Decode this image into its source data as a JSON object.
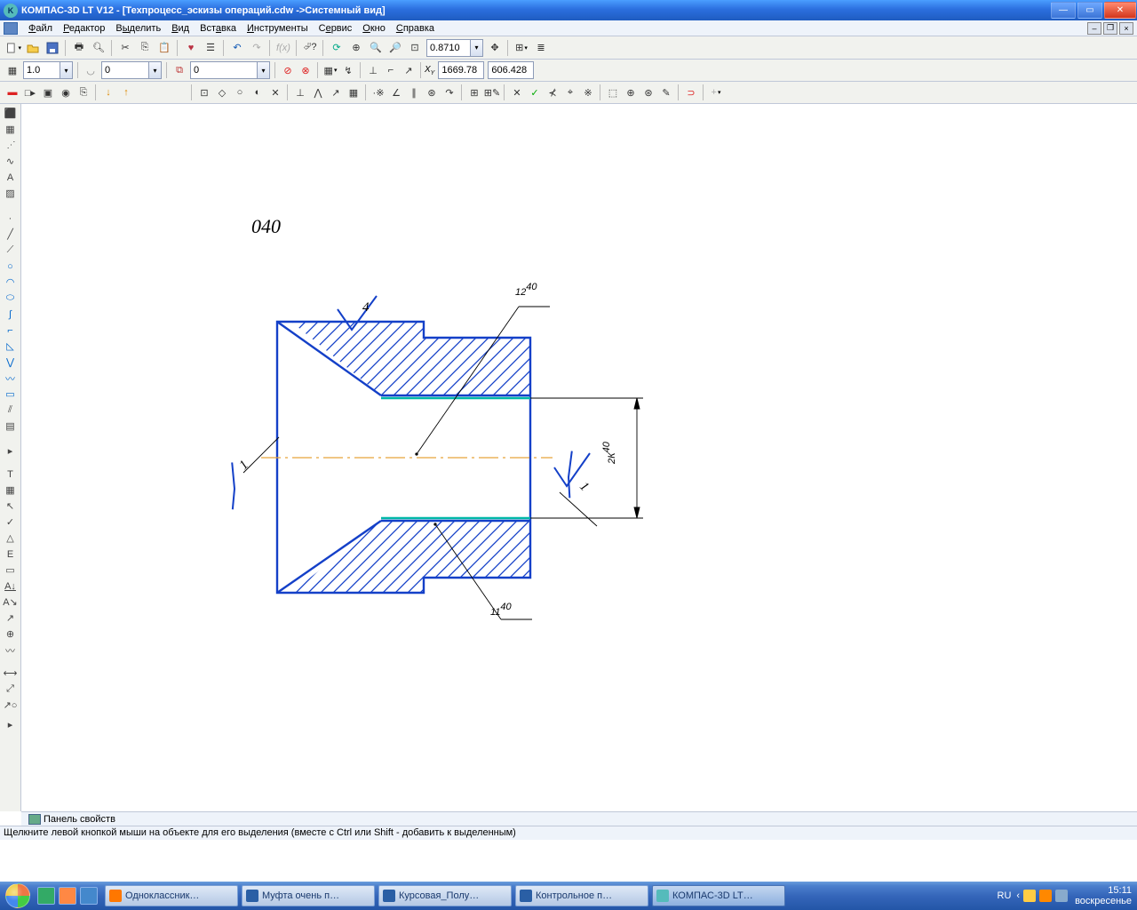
{
  "window": {
    "title": "КОМПАС-3D LT V12 - [Техпроцесс_эскизы операций.cdw ->Системный вид]"
  },
  "menu": {
    "file": "Файл",
    "editor": "Редактор",
    "select": "Выделить",
    "view": "Вид",
    "insert": "Вставка",
    "tools": "Инструменты",
    "service": "Сервис",
    "window": "Окно",
    "help": "Справка"
  },
  "toolbar2": {
    "zoom_value": "0.8710"
  },
  "toolbar3": {
    "step_value": "1.0",
    "angle_value": "0",
    "layer_value": "0",
    "coord_x": "1669.78",
    "coord_y": "606.428"
  },
  "drawing": {
    "operation_number": "040",
    "dim_r": "2К",
    "dim_r_exp": "40",
    "dim_top": "12",
    "dim_top_exp": "40",
    "dim_bot": "11",
    "dim_bot_exp": "40",
    "surf_top": "4",
    "surf_left": "1",
    "surf_right": "1"
  },
  "prop_panel": "Панель свойств",
  "status_text": "Щелкните левой кнопкой мыши на объекте для его выделения (вместе с Ctrl или Shift - добавить к выделенным)",
  "taskbar": {
    "t1": "Одноклассник…",
    "t2": "Муфта очень п…",
    "t3": "Курсовая_Полу…",
    "t4": "Контрольное п…",
    "t5": "КОМПАС-3D LT…",
    "lang": "RU",
    "time": "15:11",
    "day": "воскресенье"
  }
}
